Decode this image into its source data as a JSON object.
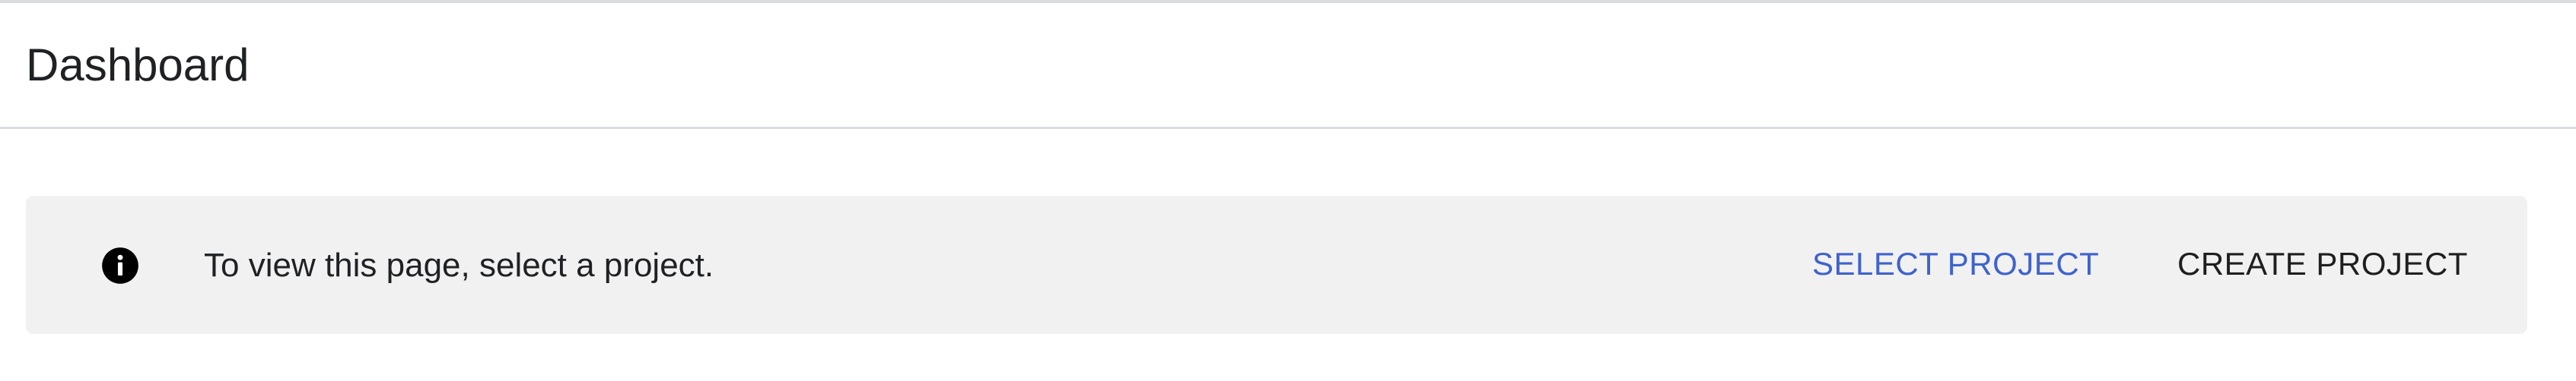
{
  "header": {
    "title": "Dashboard"
  },
  "banner": {
    "icon": "info-icon",
    "message": "To view this page, select a project.",
    "select_project_label": "SELECT PROJECT",
    "create_project_label": "CREATE PROJECT"
  },
  "colors": {
    "accent": "#3f63cc",
    "banner_background": "#f1f1f1",
    "divider": "#dadce0",
    "text": "#202124"
  }
}
